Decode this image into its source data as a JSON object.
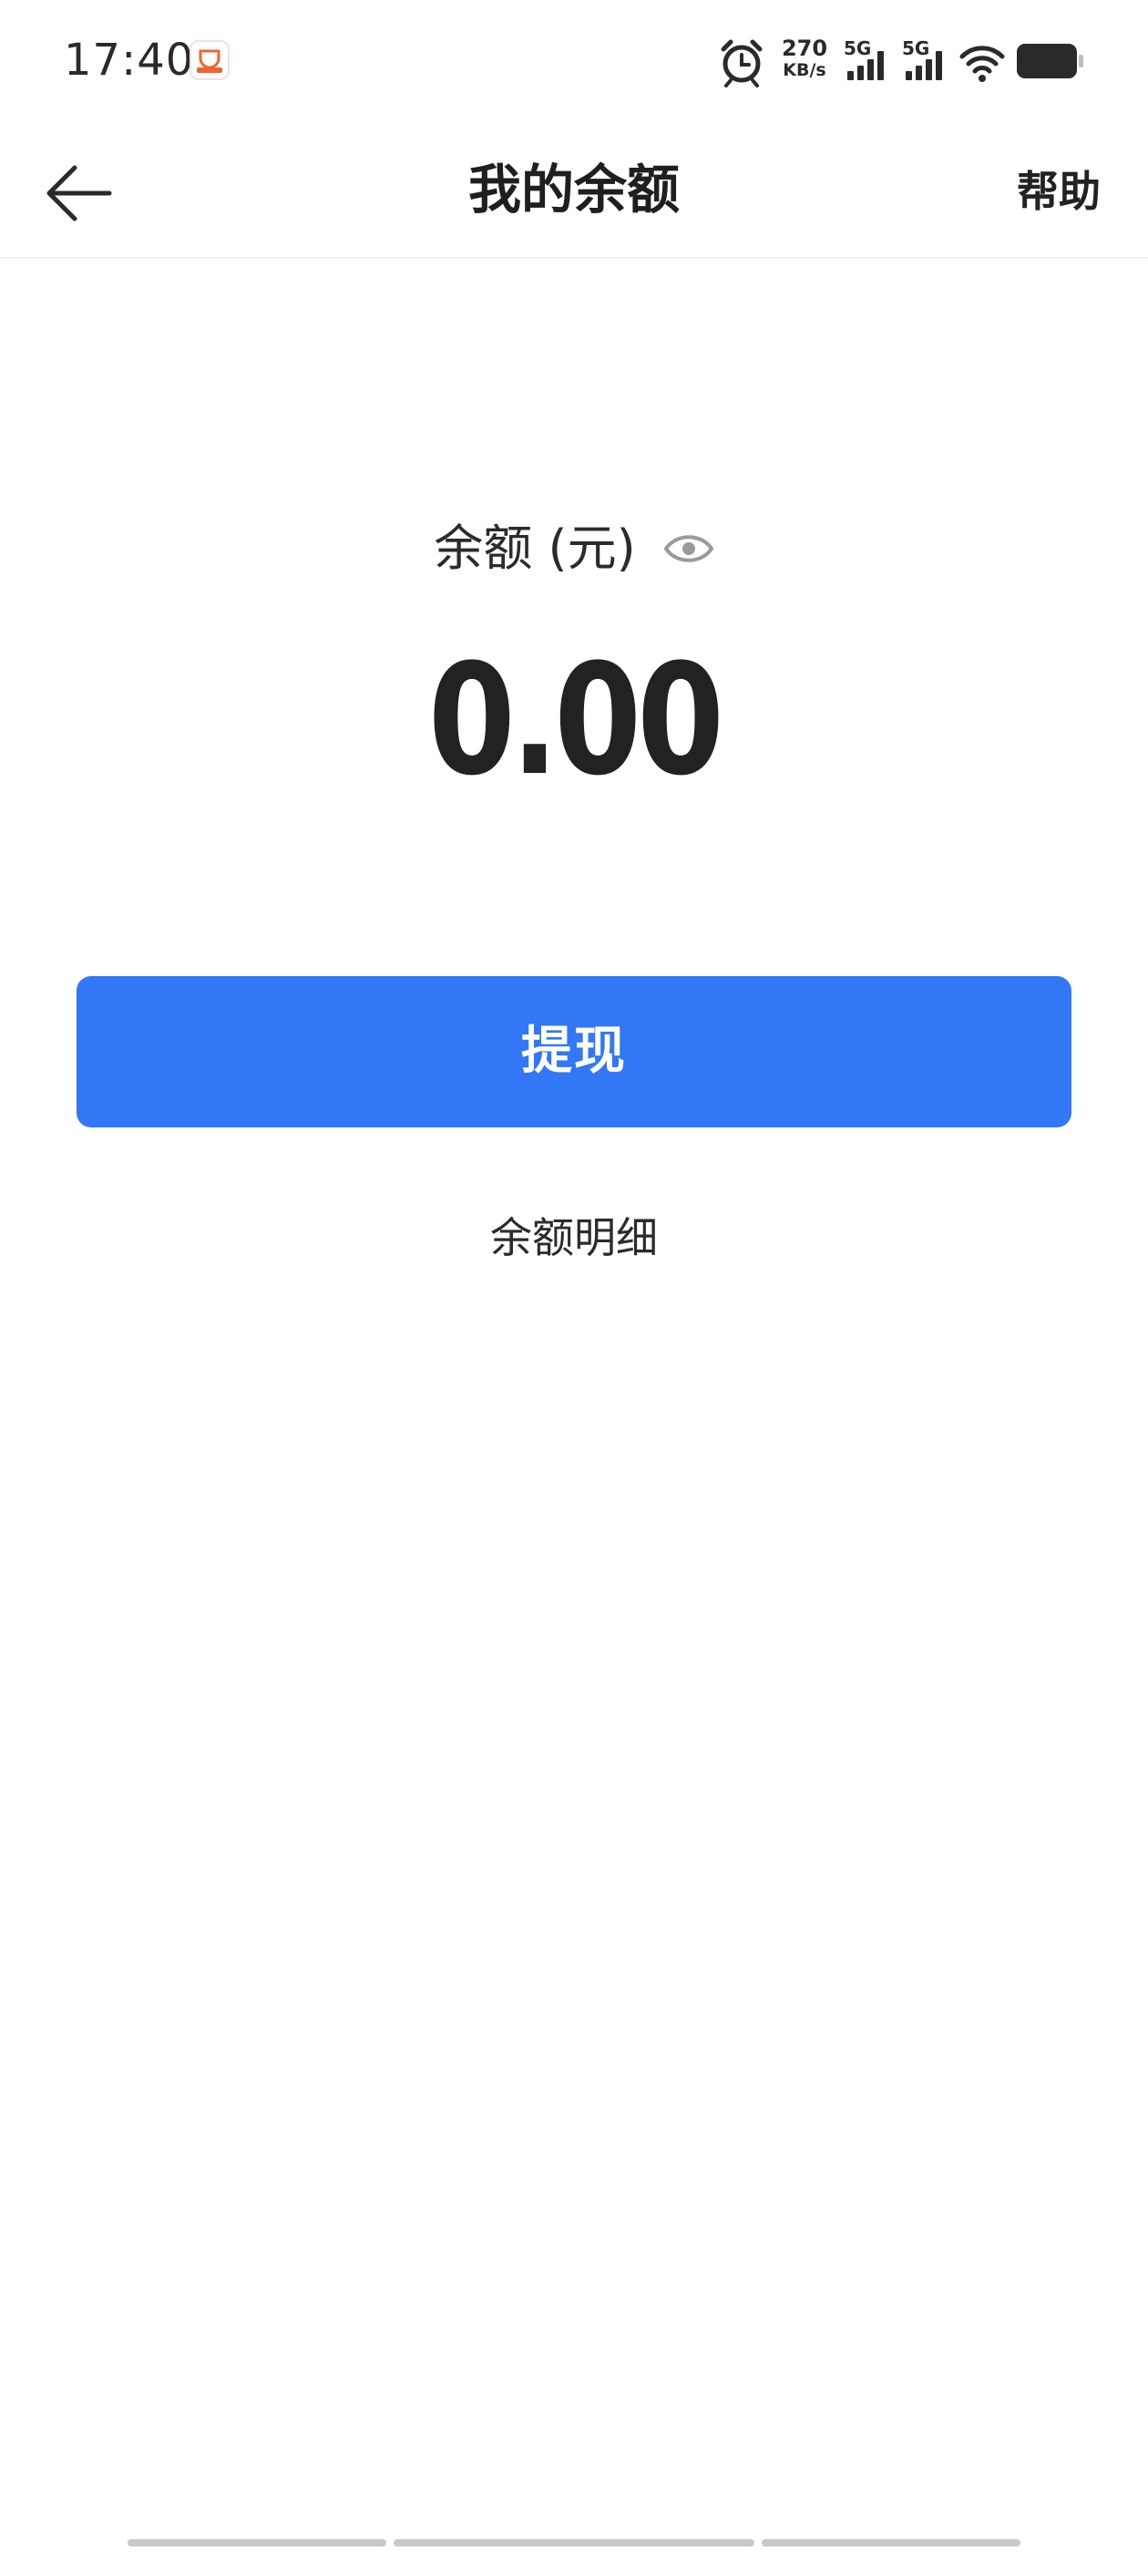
{
  "status_bar": {
    "time": "17:40",
    "net_speed_value": "270",
    "net_speed_unit": "KB/s",
    "sim1_label": "5G",
    "sim2_label": "5G",
    "icons": [
      "app-notification-icon",
      "alarm-icon",
      "signal-icon",
      "signal-icon",
      "wifi-icon",
      "battery-icon"
    ]
  },
  "nav": {
    "back_icon": "arrow-left-icon",
    "title": "我的余额",
    "help_label": "帮助"
  },
  "balance": {
    "label": "余额 (元)",
    "visibility_icon": "eye-icon",
    "amount": "0.00"
  },
  "actions": {
    "withdraw_label": "提现",
    "detail_label": "余额明细"
  },
  "colors": {
    "primary": "#3277f5",
    "text": "#222222",
    "icon_gray": "#9a9a9a"
  }
}
